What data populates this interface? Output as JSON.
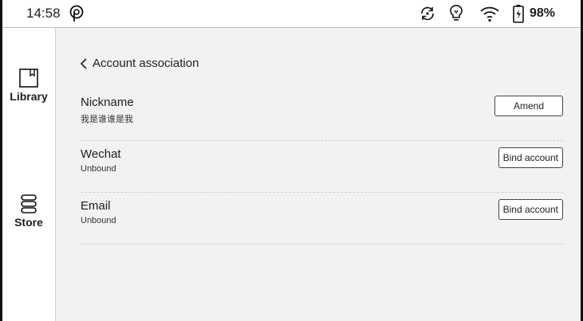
{
  "status_bar": {
    "time": "14:58",
    "battery_percent": "98%",
    "icons": [
      "p-logo-icon",
      "sync-icon",
      "frontlight-icon",
      "wifi-icon",
      "battery-icon"
    ]
  },
  "sidebar": {
    "items": [
      {
        "label": "Library",
        "icon": "book-icon"
      },
      {
        "label": "Store",
        "icon": "store-icon"
      }
    ]
  },
  "header": {
    "back_icon": "chevron-left-icon",
    "title": "Account association"
  },
  "accounts": [
    {
      "title": "Nickname",
      "value": "我是谁谁是我",
      "button": "Amend"
    },
    {
      "title": "Wechat",
      "value": "Unbound",
      "button": "Bind account"
    },
    {
      "title": "Email",
      "value": "Unbound",
      "button": "Bind account"
    }
  ]
}
